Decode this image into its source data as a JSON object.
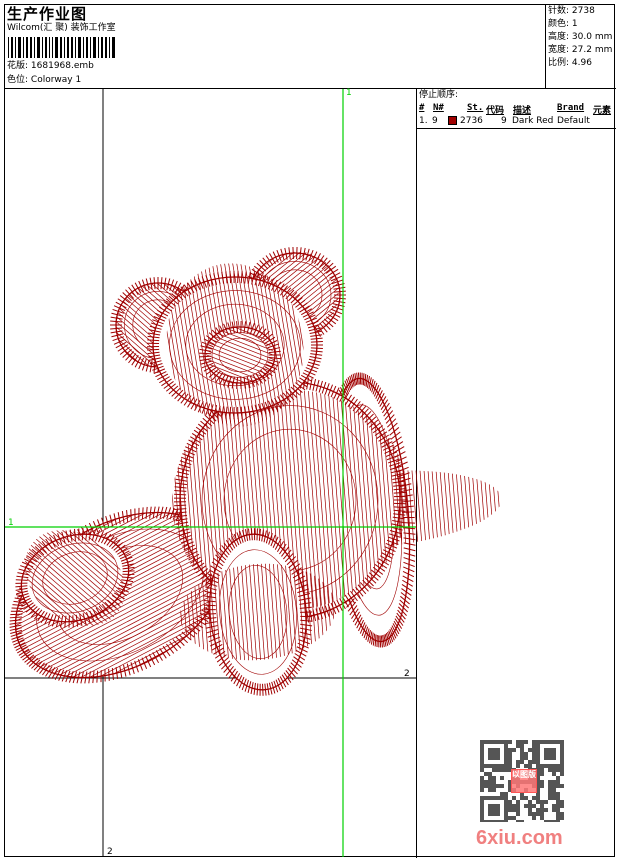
{
  "header": {
    "title": "生产作业图",
    "company": "Wilcom(汇 聚) 装饰工作室",
    "design_label": "花版:",
    "design_value": "1681968.emb",
    "colorway_label": "色位:",
    "colorway_value": "Colorway 1"
  },
  "stats": [
    {
      "label": "针数:",
      "value": "2738"
    },
    {
      "label": "颜色:",
      "value": "1"
    },
    {
      "label": "高度:",
      "value": "30.0 mm"
    },
    {
      "label": "宽度:",
      "value": "27.2 mm"
    },
    {
      "label": "比例:",
      "value": "4.96"
    }
  ],
  "stop_sequence": {
    "title": "停止顺序:",
    "columns": [
      "#",
      "N#",
      "St.",
      "代码",
      "描述",
      "Brand",
      "元素"
    ],
    "rows": [
      {
        "index": "1.",
        "needle": "9",
        "color": "#a00000",
        "stitches": "2736",
        "code": "9",
        "description": "Dark Red",
        "brand": "Default",
        "element": ""
      }
    ]
  },
  "guides": {
    "green_v": "1",
    "green_h": "1",
    "black_h": "2",
    "black_v": "2"
  },
  "colors": {
    "thread": "#a00000",
    "guide": "#00d000"
  },
  "watermark": {
    "text": "6xiu.com",
    "stamp": "以图版"
  }
}
